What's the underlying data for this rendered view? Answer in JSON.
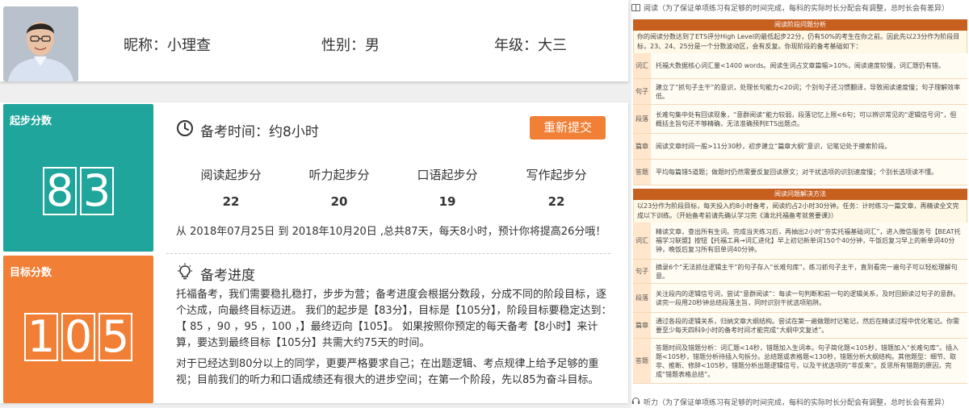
{
  "profile": {
    "nickname": "昵称：小理查",
    "gender": "性别：男",
    "grade": "年级：大三"
  },
  "start_score": {
    "title": "起步分数",
    "digits": [
      "8",
      "3"
    ]
  },
  "target_score": {
    "title": "目标分数",
    "digits": [
      "1",
      "0",
      "5"
    ]
  },
  "prep_time": {
    "label": "备考时间：约8小时",
    "resubmit": "重新提交"
  },
  "skills": [
    {
      "label": "阅读起步分",
      "value": "22"
    },
    {
      "label": "听力起步分",
      "value": "20"
    },
    {
      "label": "口语起步分",
      "value": "19"
    },
    {
      "label": "写作起步分",
      "value": "22"
    }
  ],
  "summary": "从 2018年07月25日 到 2018年10月20日 ,总共87天，每天8小时，预计你将提高26分哦！",
  "progress": {
    "title": "备考进度",
    "p1": "托福备考，我们需要稳扎稳打，步步为营；备考进度会根据分数段，分成不同的阶段目标，逐个达成，向最终目标迈进。 我们的起步是【83分】，目标是【105分】，阶段目标要稳定达到：【 85 ，90 ，95 ，100 ，】最终迈向【105】。 如果按照你预定的每天备考【8小时】来计算，要达到最终目标【105分】共需大约75天的时间。",
    "p2": "对于已经达到80分以上的同学，更要严格要求自己；在出题逻辑、考点规律上给予足够的重视；目前我们的听力和口语成绩还有很大的进步空间；在第一个阶段，先以85为奋斗目标。"
  },
  "right": {
    "reading_note": "阅读（为了保证单项练习有足够的时间完成，每科的实际时长分配会有调整，总时长会有差异）",
    "analysis_title": "阅读阶段问题分析",
    "analysis_intro": "你的阅读分数达到了ETS评分High Level的最低起步22分，仍有50%的考生在你之前。因此先以23分作为阶段目标，23、24、25分是一个分数波动区，会有反复。你现阶段的备考基础如下：",
    "analysis_rows": [
      {
        "label": "词汇",
        "text": "托福大数据核心词汇量<1400 words。阅读生词占文章篇幅>10%，阅读速度较慢，词汇题仍有错。"
      },
      {
        "label": "句子",
        "text": "建立了“抓句子主干”的意识，处理长句能力<20词；个别句子还习惯翻译，导致阅读速度慢；句子理解效率低。"
      },
      {
        "label": "段落",
        "text": "长难句集中处有回读现象，“意群阅读”能力较弱，段落记忆上限<6句；可以辨识常见的“逻辑信号词”，但概括主旨句还不够精确，无法准确预判ETS出题点。"
      },
      {
        "label": "篇章",
        "text": "阅读文章时间一般>11分30秒，初步建立“篇章大纲”意识，记笔记处于摸索阶段。"
      },
      {
        "label": "答题",
        "text": "平均每篇错5道题；做题时仍然需要反复回读原文；对干扰选项的识别速度慢；个别长选项读不懂。"
      }
    ],
    "solution_title": "阅读问题解决方法",
    "solution_intro": "以23分作为阶段目标，每天投入约8小时备考，阅读约占2小时30分钟。任务：计时练习一篇文章，再精读全文完成以下训练。（开始备考前请先确认学习完《清北托福备考就普要课》）",
    "solution_rows": [
      {
        "label": "词汇",
        "text": "精读文章，查出所有生词。完成当天练习后，再抽出2小时“夯实托福基础词汇”，进入微信服务号【BEAT托福学习联盟】按钮【托福工具→词汇进化】早上初记新单词150个40分钟，午饭后复习早上的新单词40分钟，晚饭后复习所有旧单词40分钟。"
      },
      {
        "label": "句子",
        "text": "摘录6个“无法抓住逻辑主干”的句子存入“长难句库”，练习抓句子主干，直到看完一遍句子可以轻松理解句意。"
      },
      {
        "label": "段落",
        "text": "关注段内的逻辑信号词，尝试“意群阅读”：每读一句判断和前一句的逻辑关系，及时回顾读过句子的意群。读完一段用20秒钟总结段落主旨，同时识别干扰选项陷阱。"
      },
      {
        "label": "篇章",
        "text": "通过各段的逻辑关系，归纳文章大纲结构。尝试在第一遍做题时记笔记，然后在精读过程中优化笔记。你需要至少每天四科9小时的备考时间才能完成“大纲中文复述”。"
      },
      {
        "label": "答题",
        "text": "答题时间及错题分析：词汇题<14秒，错题加入生词本。句子简化题<105秒，错题加入“长难句库”。插入题<105秒，错题分析待插入句拆分。总结题或表格题<130秒，错题分析大纲结构。其他题型：细节、取非、推断、修辞<105秒，错题分析出题逻辑信号，以及干扰选项的“非反来”。反思所有错题的原因，完成“错题表格总结”。"
      }
    ],
    "listening_note": "听力（为了保证单项练习有足够的时间完成，每科的实际时长分配会有调整，总时长会有差异）"
  }
}
